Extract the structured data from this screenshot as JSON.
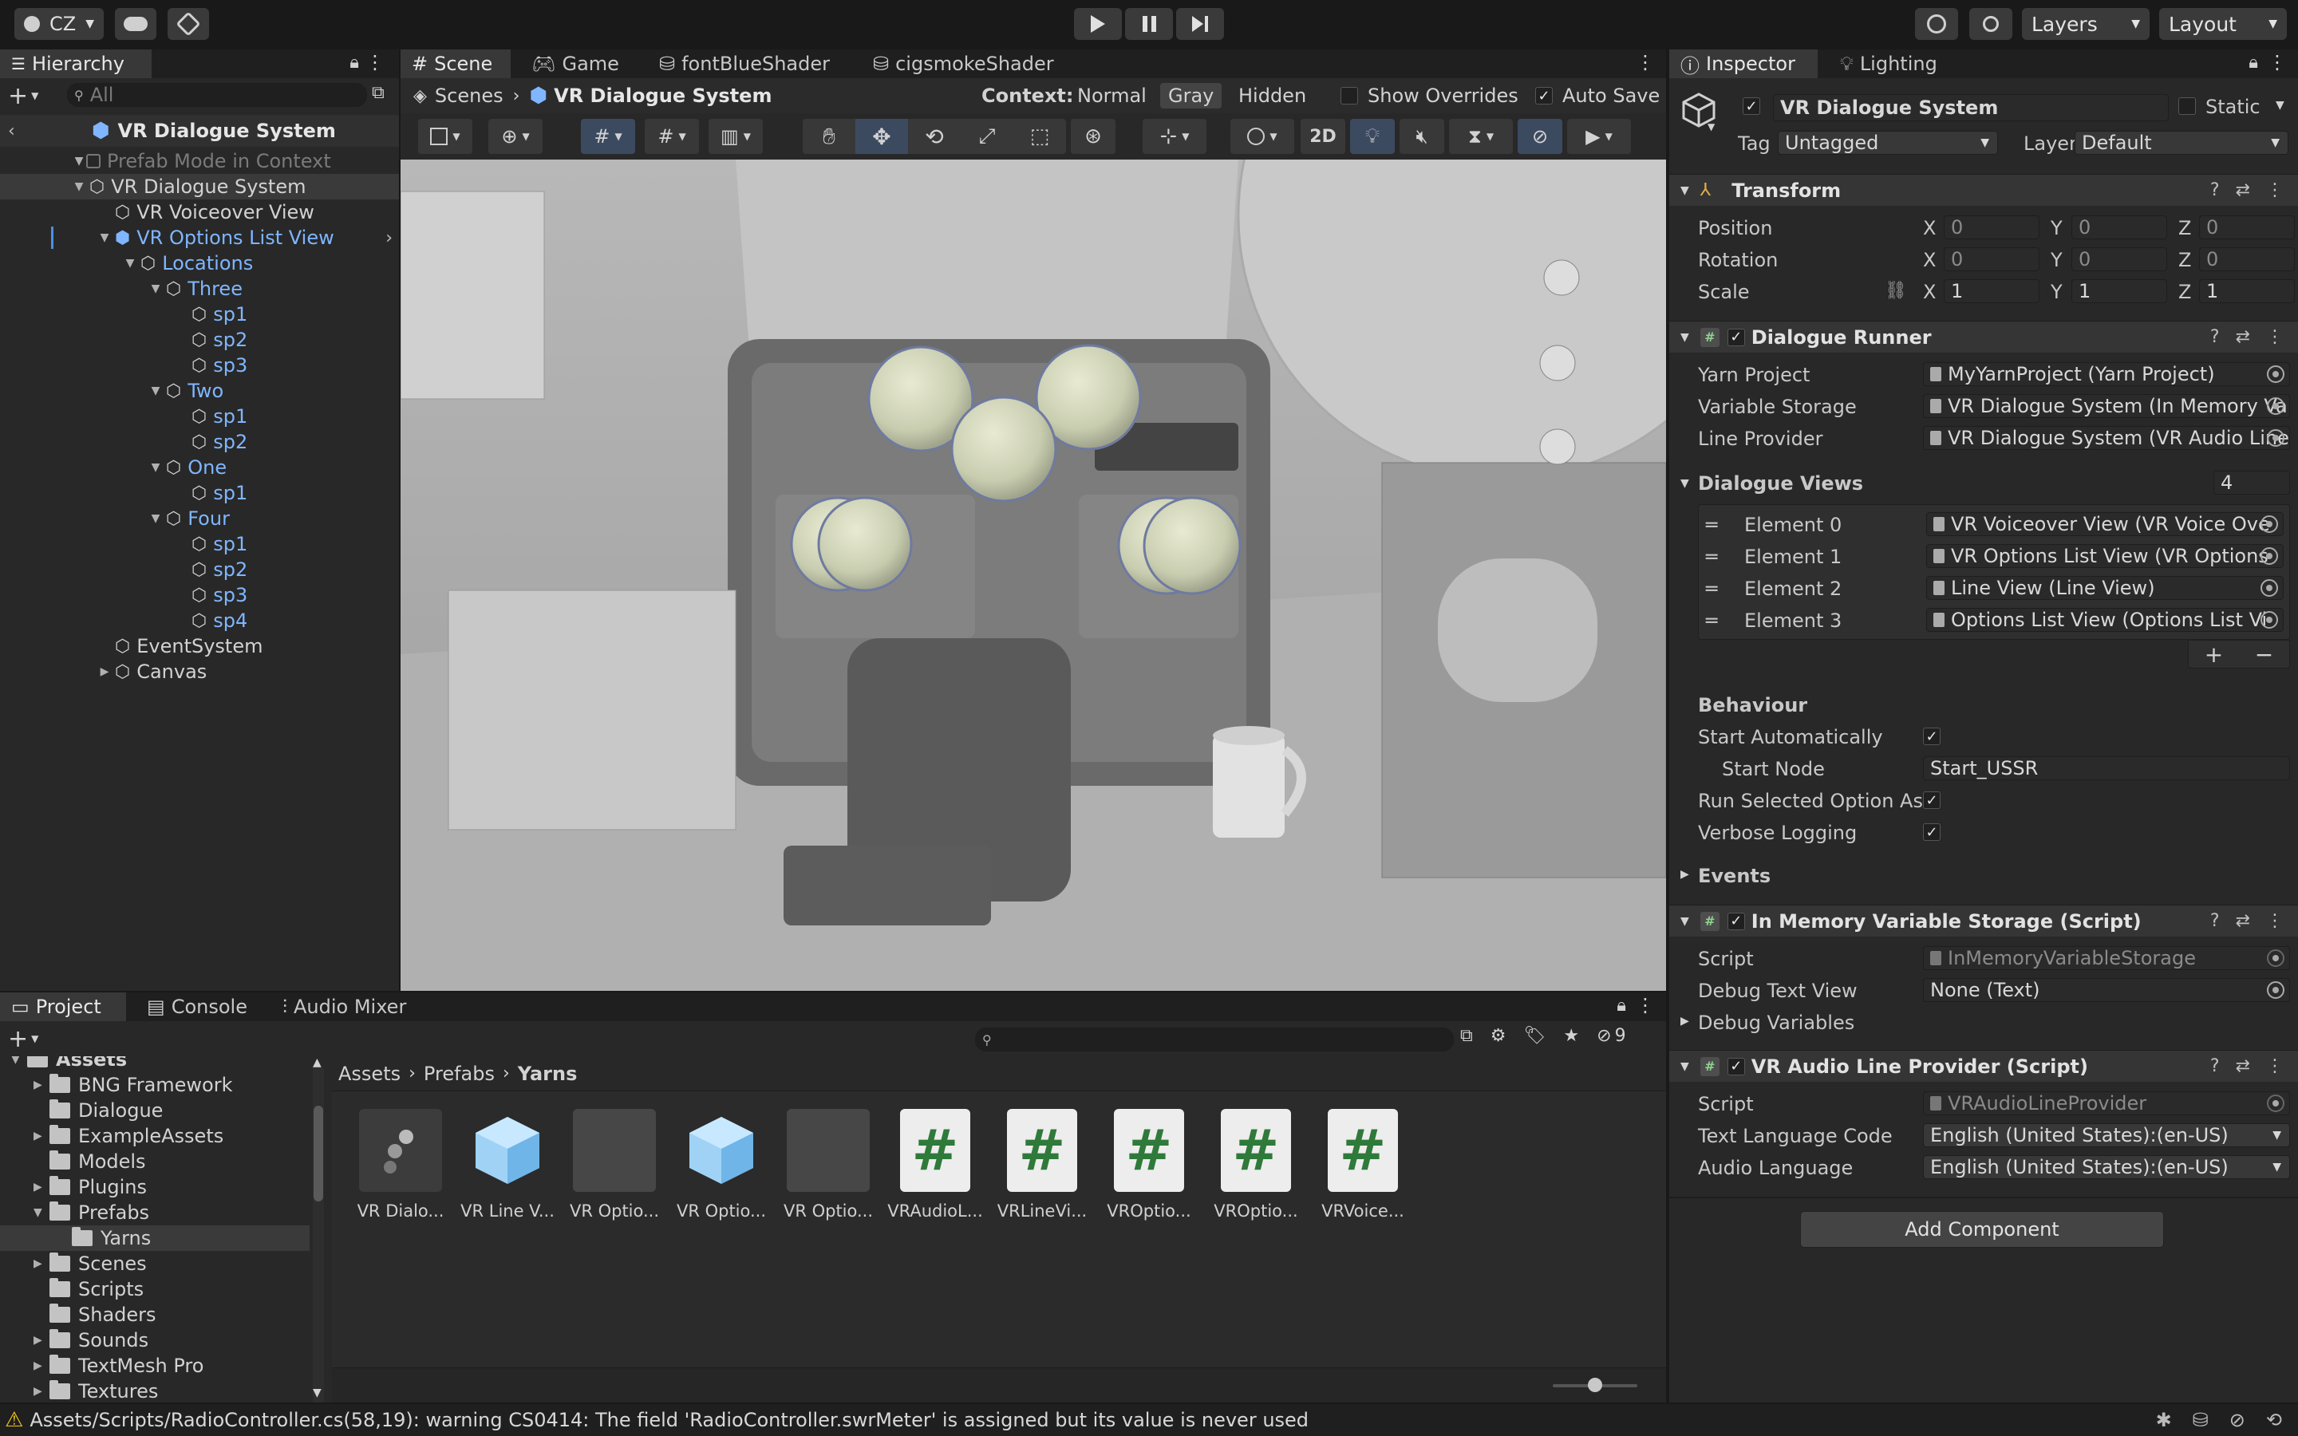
{
  "toolbar": {
    "account": "CZ",
    "layers": "Layers",
    "layout": "Layout"
  },
  "hierarchy": {
    "tab": "Hierarchy",
    "search_placeholder": "All",
    "root": "VR Dialogue System",
    "context_label": "Prefab Mode in Context",
    "items": [
      {
        "label": "VR Dialogue System",
        "depth": 1
      },
      {
        "label": "VR Voiceover View",
        "depth": 2
      },
      {
        "label": "VR Options List View",
        "depth": 2
      },
      {
        "label": "Locations",
        "depth": 3
      },
      {
        "label": "Three",
        "depth": 4
      },
      {
        "label": "sp1",
        "depth": 5
      },
      {
        "label": "sp2",
        "depth": 5
      },
      {
        "label": "sp3",
        "depth": 5
      },
      {
        "label": "Two",
        "depth": 4
      },
      {
        "label": "sp1",
        "depth": 5
      },
      {
        "label": "sp2",
        "depth": 5
      },
      {
        "label": "One",
        "depth": 4
      },
      {
        "label": "sp1",
        "depth": 5
      },
      {
        "label": "Four",
        "depth": 4
      },
      {
        "label": "sp1",
        "depth": 5
      },
      {
        "label": "sp2",
        "depth": 5
      },
      {
        "label": "sp3",
        "depth": 5
      },
      {
        "label": "sp4",
        "depth": 5
      },
      {
        "label": "EventSystem",
        "depth": 2
      },
      {
        "label": "Canvas",
        "depth": 2
      }
    ]
  },
  "scene": {
    "tabs": [
      "Scene",
      "Game",
      "fontBlueShader",
      "cigsmokeShader"
    ],
    "breadcrumb_root": "Scenes",
    "breadcrumb_current": "VR Dialogue System",
    "context_label": "Context:",
    "context_options": [
      "Normal",
      "Gray",
      "Hidden"
    ],
    "show_overrides": "Show Overrides",
    "auto_save": "Auto Save",
    "mode_2d": "2D"
  },
  "inspector": {
    "tabs": [
      "Inspector",
      "Lighting"
    ],
    "object_name": "VR Dialogue System",
    "static_label": "Static",
    "tag_label": "Tag",
    "tag_value": "Untagged",
    "layer_label": "Layer",
    "layer_value": "Default",
    "transform": {
      "title": "Transform",
      "position_label": "Position",
      "rotation_label": "Rotation",
      "scale_label": "Scale",
      "position": [
        "0",
        "0",
        "0"
      ],
      "rotation": [
        "0",
        "0",
        "0"
      ],
      "scale": [
        "1",
        "1",
        "1"
      ],
      "axes": [
        "X",
        "Y",
        "Z"
      ]
    },
    "dialogue_runner": {
      "title": "Dialogue Runner",
      "yarn_project_label": "Yarn Project",
      "yarn_project_value": "MyYarnProject (Yarn Project)",
      "variable_storage_label": "Variable Storage",
      "variable_storage_value": "VR Dialogue System (In Memory Va",
      "line_provider_label": "Line Provider",
      "line_provider_value": "VR Dialogue System (VR Audio Line",
      "dialogue_views_label": "Dialogue Views",
      "dialogue_views_count": "4",
      "elements": [
        {
          "label": "Element 0",
          "value": "VR Voiceover View (VR Voice Ove"
        },
        {
          "label": "Element 1",
          "value": "VR Options List View (VR Options"
        },
        {
          "label": "Element 2",
          "value": "Line View (Line View)"
        },
        {
          "label": "Element 3",
          "value": "Options List View (Options List Vi"
        }
      ],
      "behaviour_label": "Behaviour",
      "start_auto_label": "Start Automatically",
      "start_node_label": "Start Node",
      "start_node_value": "Start_USSR",
      "run_selected_label": "Run Selected Option As l",
      "verbose_label": "Verbose Logging",
      "events_label": "Events"
    },
    "memory_storage": {
      "title": "In Memory Variable Storage (Script)",
      "script_label": "Script",
      "script_value": "InMemoryVariableStorage",
      "debug_text_label": "Debug Text View",
      "debug_text_value": "None (Text)",
      "debug_vars_label": "Debug Variables"
    },
    "audio_line_provider": {
      "title": "VR Audio Line Provider (Script)",
      "script_label": "Script",
      "script_value": "VRAudioLineProvider",
      "text_lang_label": "Text Language Code",
      "text_lang_value": "English (United States):(en-US)",
      "audio_lang_label": "Audio Language",
      "audio_lang_value": "English (United States):(en-US)"
    },
    "add_component": "Add Component"
  },
  "project": {
    "tabs": [
      "Project",
      "Console",
      "Audio Mixer"
    ],
    "hidden_count": "9",
    "breadcrumb": [
      "Assets",
      "Prefabs",
      "Yarns"
    ],
    "folders": [
      {
        "label": "Assets",
        "depth": 0
      },
      {
        "label": "BNG Framework",
        "depth": 1
      },
      {
        "label": "Dialogue",
        "depth": 1
      },
      {
        "label": "ExampleAssets",
        "depth": 1
      },
      {
        "label": "Models",
        "depth": 1
      },
      {
        "label": "Plugins",
        "depth": 1
      },
      {
        "label": "Prefabs",
        "depth": 1
      },
      {
        "label": "Yarns",
        "depth": 2
      },
      {
        "label": "Scenes",
        "depth": 1
      },
      {
        "label": "Scripts",
        "depth": 1
      },
      {
        "label": "Shaders",
        "depth": 1
      },
      {
        "label": "Sounds",
        "depth": 1
      },
      {
        "label": "TextMesh Pro",
        "depth": 1
      },
      {
        "label": "Textures",
        "depth": 1
      }
    ],
    "assets": [
      {
        "label": "VR Dialo...",
        "kind": "prefab-variant"
      },
      {
        "label": "VR Line V...",
        "kind": "prefab"
      },
      {
        "label": "VR Optio...",
        "kind": "empty"
      },
      {
        "label": "VR Optio...",
        "kind": "prefab"
      },
      {
        "label": "VR Optio...",
        "kind": "empty"
      },
      {
        "label": "VRAudioL...",
        "kind": "script"
      },
      {
        "label": "VRLineVi...",
        "kind": "script"
      },
      {
        "label": "VROptio...",
        "kind": "script"
      },
      {
        "label": "VROptio...",
        "kind": "script"
      },
      {
        "label": "VRVoice...",
        "kind": "script"
      }
    ]
  },
  "status": {
    "message": "Assets/Scripts/RadioController.cs(58,19): warning CS0414: The field 'RadioController.swrMeter' is assigned but its value is never used"
  },
  "colors": {
    "accent_blue": "#7fb6ff",
    "warning": "#f0c419",
    "panel": "#282828",
    "toolbar": "#191919"
  }
}
